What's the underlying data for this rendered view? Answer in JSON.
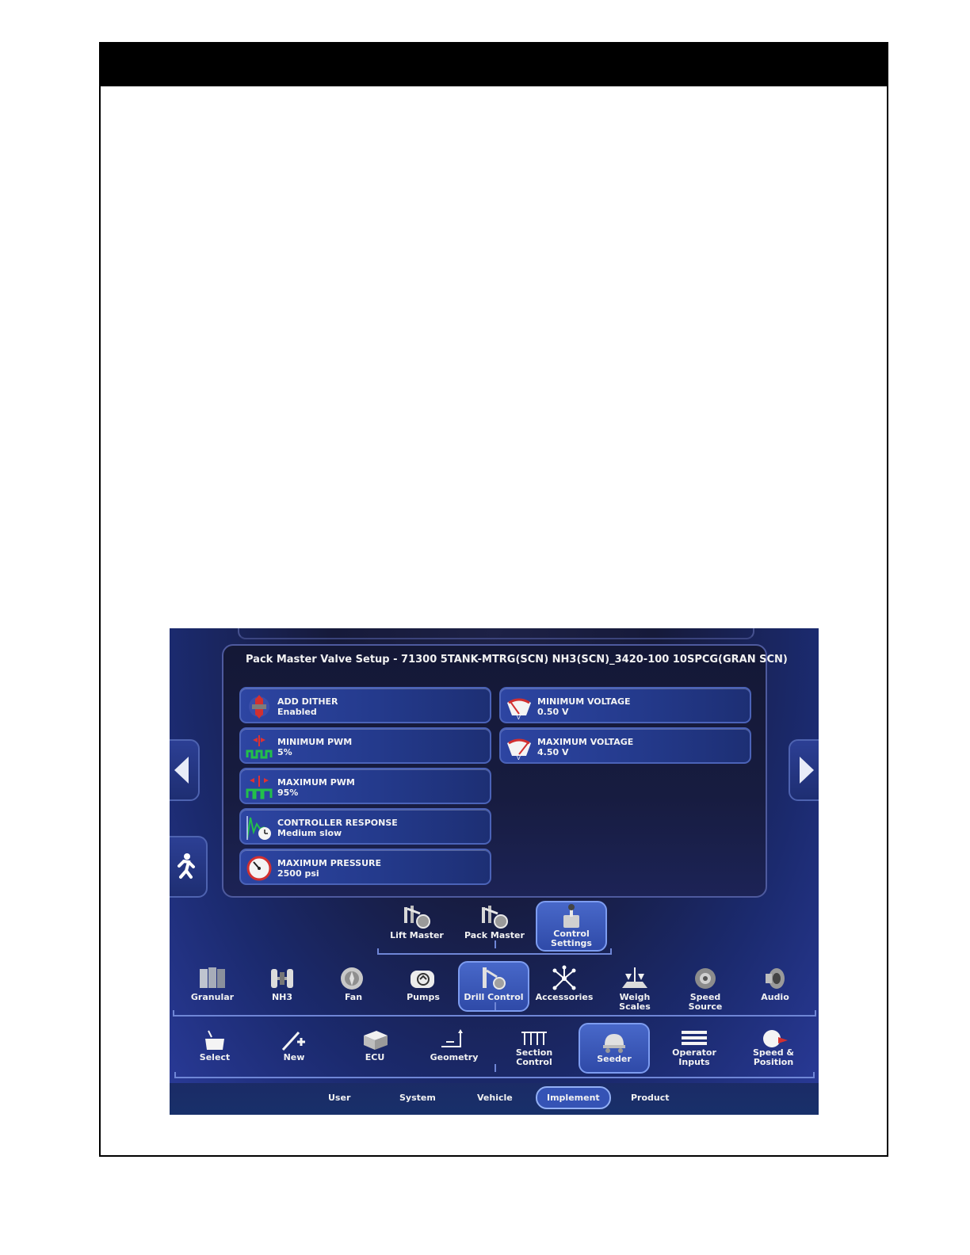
{
  "header": {
    "bar": ""
  },
  "panel": {
    "title": "Pack Master Valve Setup - 71300 5TANK-MTRG(SCN) NH3(SCN)_3420-100 10SPCG(GRAN SCN)"
  },
  "settings_left": [
    {
      "label": "ADD DITHER",
      "value": "Enabled",
      "icon": "dither-valve-icon"
    },
    {
      "label": "MINIMUM PWM",
      "value": "5%",
      "icon": "pwm-icon"
    },
    {
      "label": "MAXIMUM PWM",
      "value": "95%",
      "icon": "pwm-icon"
    },
    {
      "label": "CONTROLLER RESPONSE",
      "value": "Medium slow",
      "icon": "response-graph-icon"
    },
    {
      "label": "MAXIMUM PRESSURE",
      "value": "2500 psi",
      "icon": "pressure-gauge-icon"
    }
  ],
  "settings_right": [
    {
      "label": "MINIMUM VOLTAGE",
      "value": "0.50 V",
      "icon": "voltage-meter-icon"
    },
    {
      "label": "MAXIMUM VOLTAGE",
      "value": "4.50 V",
      "icon": "voltage-meter-icon"
    }
  ],
  "subtabs": [
    {
      "label": "Lift Master",
      "icon": "lift-master-icon"
    },
    {
      "label": "Pack Master",
      "icon": "pack-master-icon"
    },
    {
      "label": "Control Settings",
      "icon": "control-settings-icon",
      "selected": true
    }
  ],
  "seeder_tabs": [
    {
      "label": "Granular",
      "icon": "granular-icon"
    },
    {
      "label": "NH3",
      "icon": "nh3-icon"
    },
    {
      "label": "Fan",
      "icon": "fan-icon"
    },
    {
      "label": "Pumps",
      "icon": "pump-icon"
    },
    {
      "label": "Drill Control",
      "icon": "drill-control-icon",
      "selected": true
    },
    {
      "label": "Accessories",
      "icon": "accessories-icon"
    },
    {
      "label": "Weigh Scales",
      "icon": "weigh-scales-icon"
    },
    {
      "label": "Speed Source",
      "icon": "speed-source-icon"
    },
    {
      "label": "Audio",
      "icon": "audio-icon"
    }
  ],
  "implement_tabs": [
    {
      "label": "Select",
      "icon": "select-icon"
    },
    {
      "label": "New",
      "icon": "new-icon"
    },
    {
      "label": "ECU",
      "icon": "ecu-icon"
    },
    {
      "label": "Geometry",
      "icon": "geometry-icon"
    },
    {
      "label": "Section Control",
      "icon": "section-control-icon"
    },
    {
      "label": "Seeder",
      "icon": "seeder-icon",
      "selected": true
    },
    {
      "label": "Operator Inputs",
      "icon": "operator-inputs-icon"
    },
    {
      "label": "Speed & Position",
      "icon": "speed-position-icon"
    }
  ],
  "categories": [
    {
      "label": "User"
    },
    {
      "label": "System"
    },
    {
      "label": "Vehicle"
    },
    {
      "label": "Implement",
      "selected": true
    },
    {
      "label": "Product"
    }
  ]
}
